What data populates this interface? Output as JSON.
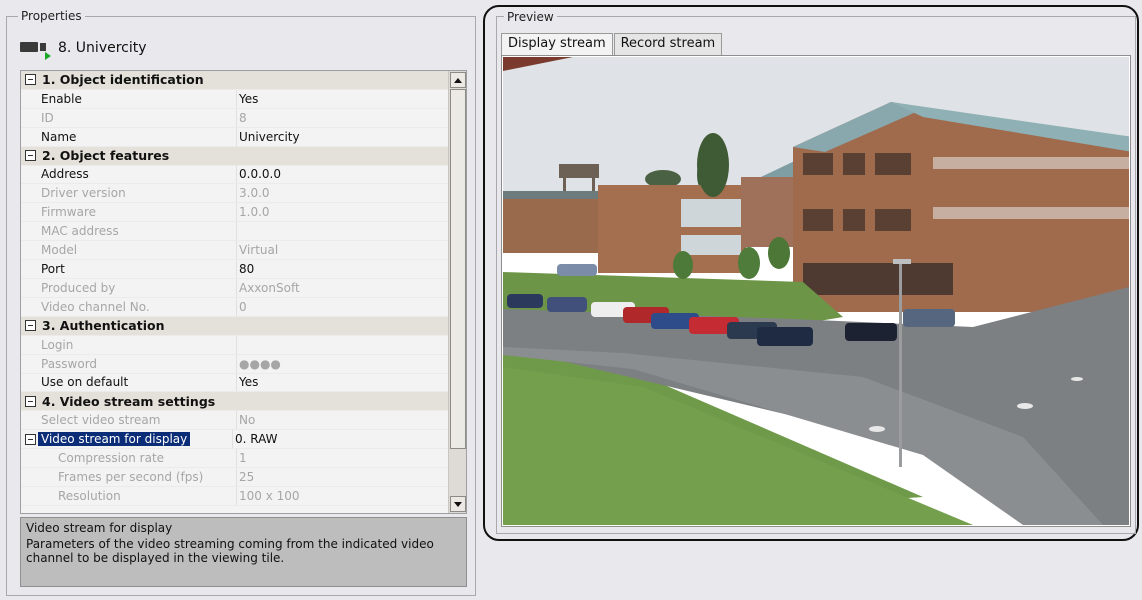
{
  "properties": {
    "title": "Properties",
    "object_name": "8. Univercity",
    "sections": [
      {
        "label": "1. Object identification",
        "rows": [
          {
            "name": "Enable",
            "value": "Yes",
            "disabled": false
          },
          {
            "name": "ID",
            "value": "8",
            "disabled": true
          },
          {
            "name": "Name",
            "value": "Univercity",
            "disabled": false
          }
        ]
      },
      {
        "label": "2. Object features",
        "rows": [
          {
            "name": "Address",
            "value": "0.0.0.0",
            "disabled": false
          },
          {
            "name": "Driver version",
            "value": "3.0.0",
            "disabled": true
          },
          {
            "name": "Firmware",
            "value": "1.0.0",
            "disabled": true
          },
          {
            "name": "MAC address",
            "value": "",
            "disabled": true
          },
          {
            "name": "Model",
            "value": "Virtual",
            "disabled": true
          },
          {
            "name": "Port",
            "value": "80",
            "disabled": false
          },
          {
            "name": "Produced by",
            "value": "AxxonSoft",
            "disabled": true
          },
          {
            "name": "Video channel No.",
            "value": "0",
            "disabled": true
          }
        ]
      },
      {
        "label": "3. Authentication",
        "rows": [
          {
            "name": "Login",
            "value": "",
            "disabled": true
          },
          {
            "name": "Password",
            "value": "●●●●",
            "disabled": true
          },
          {
            "name": "Use on default",
            "value": "Yes",
            "disabled": false
          }
        ]
      },
      {
        "label": "4. Video stream settings",
        "rows": [
          {
            "name": "Select video stream",
            "value": "No",
            "disabled": true
          },
          {
            "name": "Video stream for display",
            "value": "0. RAW",
            "disabled": false,
            "selected": true
          },
          {
            "name": "Compression rate",
            "value": "1",
            "disabled": true,
            "indent": true
          },
          {
            "name": "Frames per second (fps)",
            "value": "25",
            "disabled": true,
            "indent": true
          },
          {
            "name": "Resolution",
            "value": "100 x 100",
            "disabled": true,
            "indent": true
          }
        ]
      }
    ],
    "description": {
      "title": "Video stream for display",
      "text": "Parameters of the video streaming coming from the indicated video channel to be displayed in the viewing tile."
    }
  },
  "preview": {
    "title": "Preview",
    "tabs": [
      {
        "label": "Display stream",
        "active": true
      },
      {
        "label": "Record stream",
        "active": false
      }
    ]
  },
  "colors": {
    "selection": "#0b2c77",
    "section_bg": "#e4e1da",
    "disabled_text": "#a6a6a6",
    "play_indicator": "#1ca72c"
  }
}
